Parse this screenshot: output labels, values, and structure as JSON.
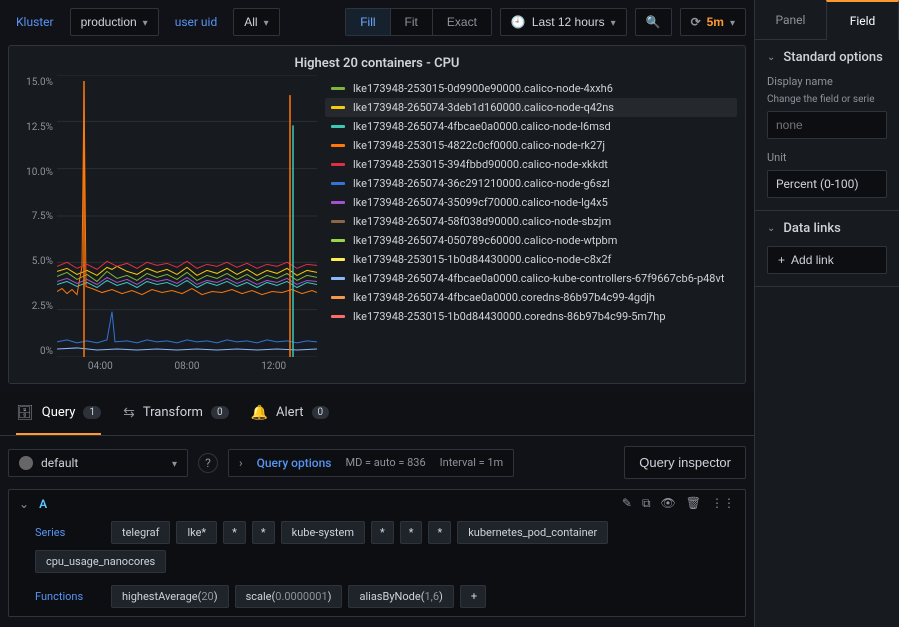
{
  "toolbar": {
    "kluster_label": "Kluster",
    "kluster_value": "production",
    "user_uid_label": "user uid",
    "user_uid_value": "All",
    "fit_modes": [
      "Fill",
      "Fit",
      "Exact"
    ],
    "fit_mode_active": 0,
    "time_range": "Last 12 hours",
    "refresh_interval": "5m"
  },
  "panel": {
    "title": "Highest 20 containers - CPU"
  },
  "chart_data": {
    "type": "line",
    "title": "Highest 20 containers - CPU",
    "xlabel": "",
    "ylabel": "",
    "y_ticks": [
      "15.0%",
      "12.5%",
      "10.0%",
      "7.5%",
      "5.0%",
      "2.5%",
      "0%"
    ],
    "ylim": [
      0,
      15
    ],
    "x_ticks": [
      "04:00",
      "08:00",
      "12:00"
    ],
    "series": [
      {
        "name": "lke173948-253015-0d9900e90000.calico-node-4xxh6",
        "color": "#7fb53a",
        "hl": false
      },
      {
        "name": "lke173948-265074-3deb1d160000.calico-node-q42ns",
        "color": "#f2cc0c",
        "hl": true
      },
      {
        "name": "lke173948-265074-4fbcae0a0000.calico-node-l6msd",
        "color": "#3cc7b7",
        "hl": false
      },
      {
        "name": "lke173948-253015-4822c0cf0000.calico-node-rk27j",
        "color": "#ff780a",
        "hl": false
      },
      {
        "name": "lke173948-253015-394fbbd90000.calico-node-xkkdt",
        "color": "#e02f44",
        "hl": false
      },
      {
        "name": "lke173948-265074-36c291210000.calico-node-g6szl",
        "color": "#3274d9",
        "hl": false
      },
      {
        "name": "lke173948-265074-35099cf70000.calico-node-lg4x5",
        "color": "#a352cc",
        "hl": false
      },
      {
        "name": "lke173948-265074-58f038d90000.calico-node-sbzjm",
        "color": "#8a6644",
        "hl": false
      },
      {
        "name": "lke173948-265074-050789c60000.calico-node-wtpbm",
        "color": "#96d64b",
        "hl": false
      },
      {
        "name": "lke173948-253015-1b0d84430000.calico-node-c8x2f",
        "color": "#ffee52",
        "hl": false
      },
      {
        "name": "lke173948-265074-4fbcae0a0000.calico-kube-controllers-67f9667cb6-p48vt",
        "color": "#8ab8ff",
        "hl": false
      },
      {
        "name": "lke173948-265074-4fbcae0a0000.coredns-86b97b4c99-4gdjh",
        "color": "#f2994a",
        "hl": false
      },
      {
        "name": "lke173948-253015-1b0d84430000.coredns-86b97b4c99-5m7hp",
        "color": "#ff6b6b",
        "hl": false
      }
    ]
  },
  "tabs": {
    "query": {
      "label": "Query",
      "count": "1"
    },
    "transform": {
      "label": "Transform",
      "count": "0"
    },
    "alert": {
      "label": "Alert",
      "count": "0"
    }
  },
  "query_bar": {
    "datasource": "default",
    "options_label": "Query options",
    "md_text": "MD = auto = 836",
    "interval_text": "Interval = 1m",
    "inspector_btn": "Query inspector"
  },
  "query_row": {
    "ref_id": "A",
    "series_key": "Series",
    "functions_key": "Functions",
    "series_tokens": [
      "telegraf",
      "lke*",
      "*",
      "*",
      "kube-system",
      "*",
      "*",
      "*",
      "kubernetes_pod_container",
      "cpu_usage_nanocores"
    ],
    "functions": [
      {
        "name": "highestAverage",
        "args": "20"
      },
      {
        "name": "scale",
        "args": "0.0000001"
      },
      {
        "name": "aliasByNode",
        "args": "1,6"
      }
    ]
  },
  "side": {
    "tabs": {
      "panel": "Panel",
      "field": "Field"
    },
    "standard_section": "Standard options",
    "display_name_label": "Display name",
    "display_name_help": "Change the field or serie",
    "display_name_placeholder": "none",
    "unit_label": "Unit",
    "unit_value": "Percent (0-100)",
    "datalinks_section": "Data links",
    "add_link_btn": "Add link"
  }
}
